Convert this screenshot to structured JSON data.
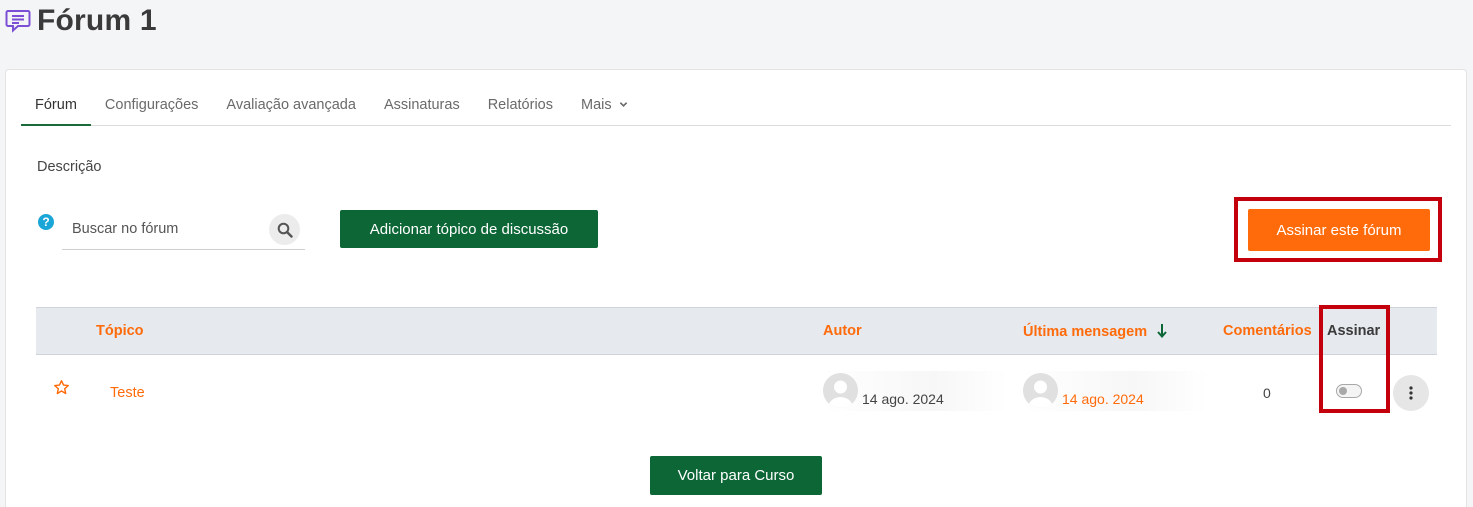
{
  "page": {
    "title": "Fórum 1",
    "icon": "forum-icon"
  },
  "tabs": [
    {
      "label": "Fórum",
      "active": true
    },
    {
      "label": "Configurações"
    },
    {
      "label": "Avaliação avançada"
    },
    {
      "label": "Assinaturas"
    },
    {
      "label": "Relatórios"
    },
    {
      "label": "Mais"
    }
  ],
  "description_label": "Descrição",
  "search": {
    "placeholder": "Buscar no fórum",
    "value": ""
  },
  "buttons": {
    "add_topic": "Adicionar tópico de discussão",
    "subscribe": "Assinar este fórum",
    "back": "Voltar para Curso"
  },
  "table": {
    "headers": {
      "topic": "Tópico",
      "author": "Autor",
      "last_message": "Última mensagem",
      "comments": "Comentários",
      "subscribe": "Assinar"
    },
    "rows": [
      {
        "topic": "Teste",
        "author_date": "14 ago. 2024",
        "last_message_date": "14 ago. 2024",
        "comments": "0",
        "subscribed": false
      }
    ]
  },
  "colors": {
    "accent_orange": "#ff6b0a",
    "primary_green": "#0c6636",
    "highlight_red": "#c4000c"
  }
}
